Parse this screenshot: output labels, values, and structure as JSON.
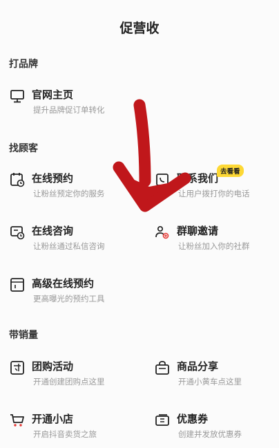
{
  "header": {
    "title": "促营收"
  },
  "sections": {
    "brand": {
      "label": "打品牌"
    },
    "customers": {
      "label": "找顾客"
    },
    "sales": {
      "label": "带销量"
    }
  },
  "items": {
    "website": {
      "name": "官网主页",
      "desc": "提升品牌促订单转化",
      "icon": "monitor-icon"
    },
    "online_booking": {
      "name": "在线预约",
      "desc": "让粉丝预定你的服务",
      "icon": "calendar-clock-icon"
    },
    "contact_us": {
      "name": "联系我们",
      "desc": "让用户拨打你的电话",
      "icon": "phone-icon",
      "badge": "去看看"
    },
    "online_consult": {
      "name": "在线咨询",
      "desc": "让粉丝通过私信咨询",
      "icon": "chat-clock-icon"
    },
    "group_invite": {
      "name": "群聊邀请",
      "desc": "让粉丝加入你的社群",
      "icon": "group-users-icon"
    },
    "advanced_booking": {
      "name": "高级在线预约",
      "desc": "更高曝光的预约工具",
      "icon": "booking-panel-icon"
    },
    "group_buy": {
      "name": "团购活动",
      "desc": "开通创建团购点这里",
      "icon": "group-buy-icon"
    },
    "product_share": {
      "name": "商品分享",
      "desc": "开通小黄车点这里",
      "icon": "shopping-bag-icon"
    },
    "open_shop": {
      "name": "开通小店",
      "desc": "开启抖音卖货之旅",
      "icon": "cart-icon"
    },
    "coupon": {
      "name": "优惠券",
      "desc": "创建并发放优惠券",
      "icon": "coupon-icon"
    }
  },
  "colors": {
    "annotation_arrow": "#c0171b",
    "badge": "#fdd835",
    "desc_text": "#999999"
  }
}
